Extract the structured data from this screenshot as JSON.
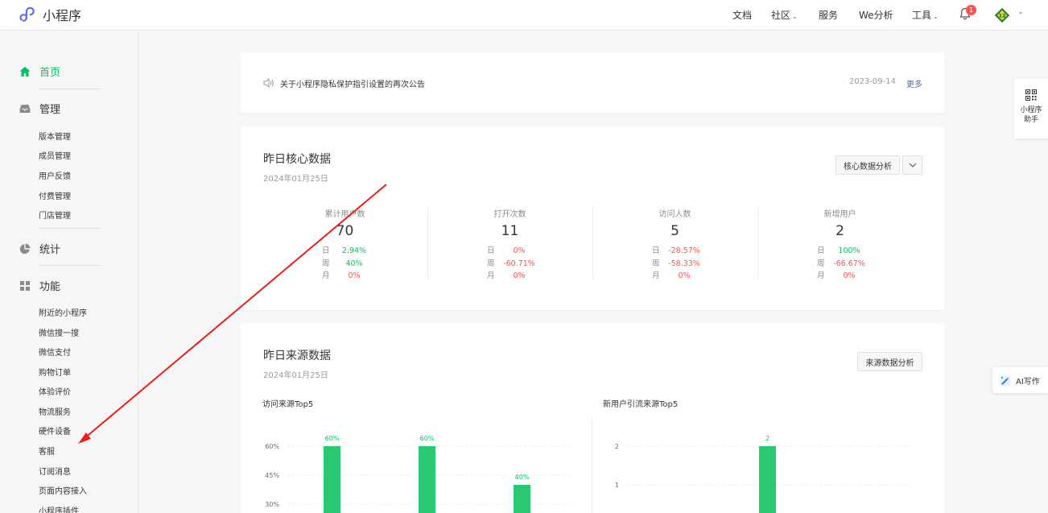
{
  "app": {
    "title": "小程序"
  },
  "nav": {
    "docs": "文档",
    "community": "社区",
    "services": "服务",
    "we_analytics": "We分析",
    "tools": "工具",
    "notification_count": "1"
  },
  "sidebar": {
    "home": "首页",
    "manage": {
      "label": "管理",
      "items": [
        "版本管理",
        "成员管理",
        "用户反馈",
        "付费管理",
        "门店管理"
      ]
    },
    "stats": "统计",
    "features": {
      "label": "功能",
      "items": [
        "附近的小程序",
        "微信搜一搜",
        "微信支付",
        "购物订单",
        "体验评价",
        "物流服务",
        "硬件设备",
        "客服",
        "订阅消息",
        "页面内容接入",
        "小程序插件"
      ]
    }
  },
  "notice": {
    "text": "关于小程序隐私保护指引设置的再次公告",
    "date": "2023-09-14",
    "more": "更多"
  },
  "core": {
    "title": "昨日核心数据",
    "date": "2024年01月25日",
    "analysis_button": "核心数据分析",
    "row_labels": [
      "日",
      "周",
      "月"
    ],
    "metrics": [
      {
        "label": "累计用户数",
        "value": "70",
        "changes": [
          "2.94%",
          "40%",
          "0%"
        ],
        "trend": [
          "up",
          "up",
          "down"
        ]
      },
      {
        "label": "打开次数",
        "value": "11",
        "changes": [
          "0%",
          "-60.71%",
          "0%"
        ],
        "trend": [
          "down",
          "down",
          "down"
        ]
      },
      {
        "label": "访问人数",
        "value": "5",
        "changes": [
          "-28.57%",
          "-58.33%",
          "0%"
        ],
        "trend": [
          "down",
          "down",
          "down"
        ]
      },
      {
        "label": "新增用户",
        "value": "2",
        "changes": [
          "100%",
          "-66.67%",
          "0%"
        ],
        "trend": [
          "up",
          "down",
          "down"
        ]
      }
    ]
  },
  "source": {
    "title": "昨日来源数据",
    "date": "2024年01月25日",
    "analysis_button": "来源数据分析",
    "left_chart_title": "访问来源Top5",
    "right_chart_title": "新用户引流来源Top5"
  },
  "chart_data": [
    {
      "type": "bar",
      "title": "访问来源Top5",
      "series": [
        {
          "values": [
            60,
            60,
            40
          ]
        }
      ],
      "data_labels": [
        "60%",
        "60%",
        "40%"
      ],
      "y_ticks": [
        "60%",
        "45%",
        "30%"
      ],
      "ylim": [
        0,
        60
      ],
      "grid": true,
      "color": "#2bc974"
    },
    {
      "type": "bar",
      "title": "新用户引流来源Top5",
      "series": [
        {
          "values": [
            2
          ]
        }
      ],
      "data_labels": [
        "2"
      ],
      "y_ticks": [
        "2",
        "1"
      ],
      "ylim": [
        0,
        2
      ],
      "grid": true,
      "color": "#2bc974"
    }
  ],
  "floating": {
    "helper": "小程序助手",
    "ai_write": "AI写作"
  },
  "colors": {
    "accent": "#07c160",
    "bar": "#2bc974",
    "negative": "#fa5151",
    "link": "#576b95",
    "annotation": "#e8201c"
  }
}
